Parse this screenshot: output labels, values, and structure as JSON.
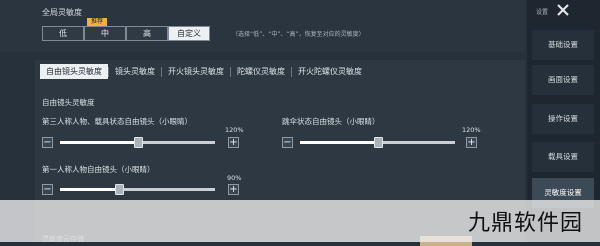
{
  "global": {
    "title": "全局灵敏度",
    "options": [
      "低",
      "中",
      "高",
      "自定义"
    ],
    "recommend_tag": "推荐",
    "hint": "（选择“低”、“中”、“高”，恢复至对应的灵敏度）"
  },
  "tabs": [
    "自由镜头灵敏度",
    "镜头灵敏度",
    "开火镜头灵敏度",
    "陀螺仪灵敏度",
    "开火陀螺仪灵敏度"
  ],
  "section_title": "自由镜头灵敏度",
  "sliders": [
    {
      "label": "第三人称人物、载具状态自由镜头（小眼睛）",
      "value_text": "120%",
      "fraction": 0.5
    },
    {
      "label": "跳伞状态自由镜头（小眼睛）",
      "value_text": "120%",
      "fraction": 0.5
    },
    {
      "label": "第一人称人物自由镜头（小眼睛）",
      "value_text": "90%",
      "fraction": 0.38
    }
  ],
  "slider_minus": "−",
  "slider_plus": "+",
  "sidebar": {
    "top_label": "设置",
    "items": [
      "基础设置",
      "画面设置",
      "操作设置",
      "载具设置",
      "灵敏度设置"
    ],
    "active_index": 4
  },
  "bottom_label": "灵敏度云存储",
  "watermark": "九鼎软件园"
}
